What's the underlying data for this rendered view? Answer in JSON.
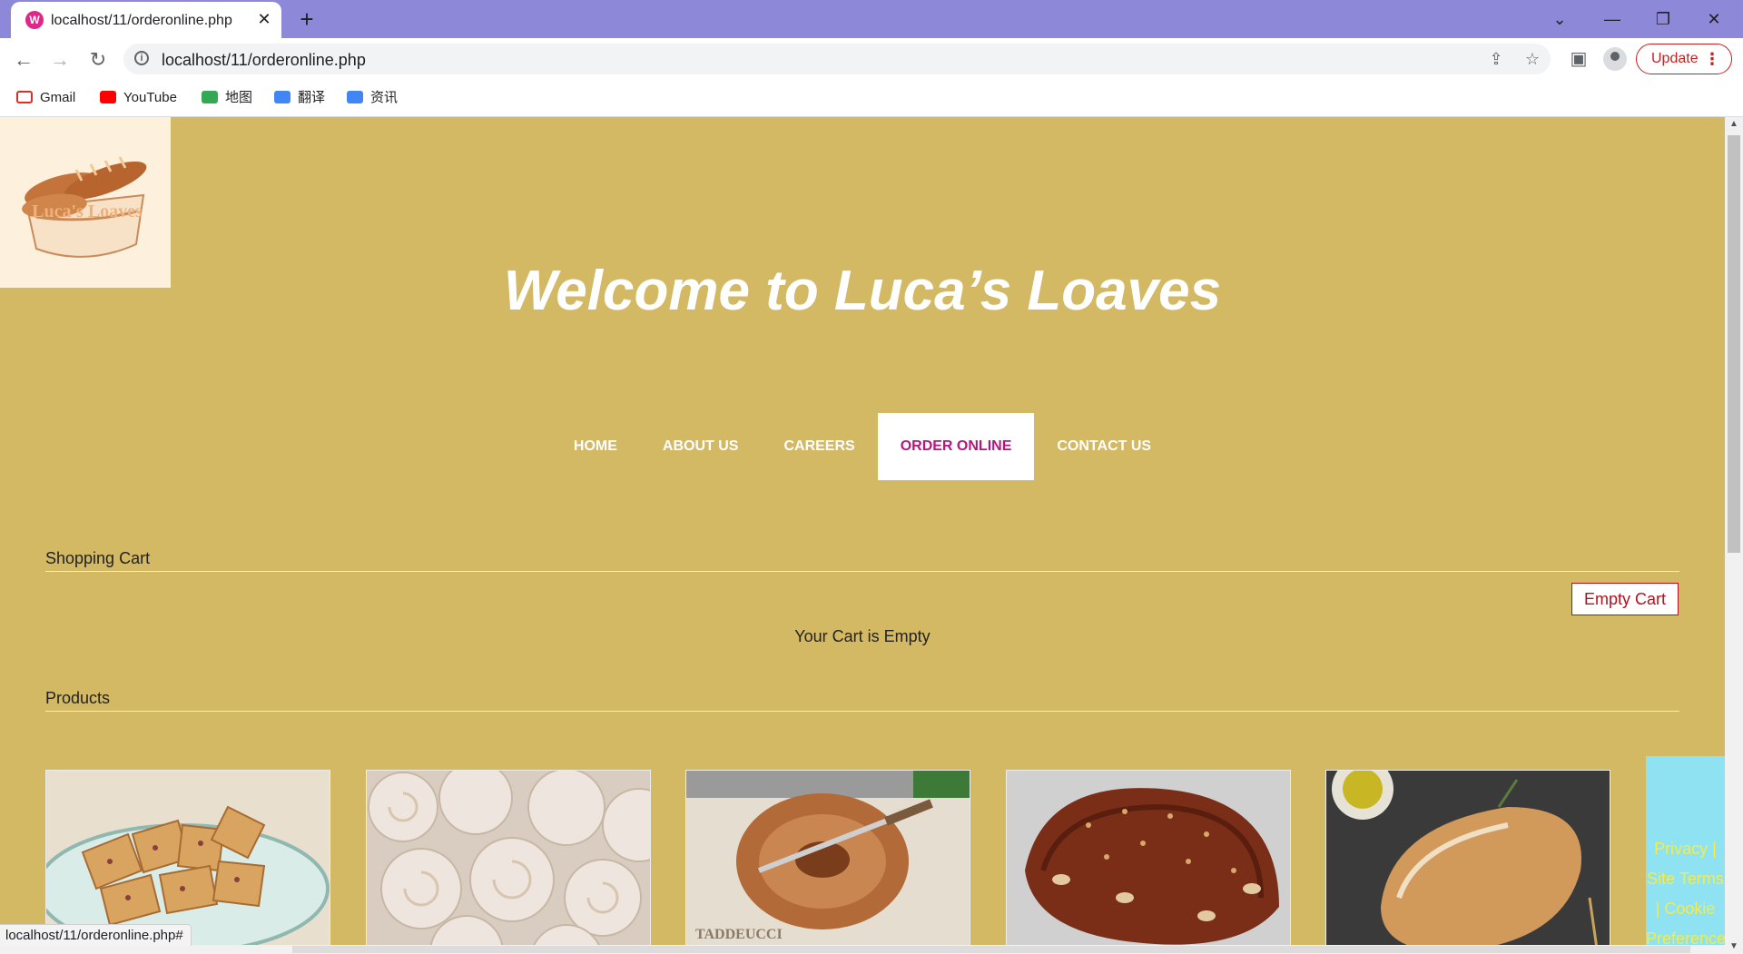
{
  "browser": {
    "tab_title": "localhost/11/orderonline.php",
    "tab_close": "✕",
    "new_tab": "+",
    "url": "localhost/11/orderonline.php",
    "update_label": "Update",
    "window_controls": [
      "⌄",
      "—",
      "❐",
      "✕"
    ],
    "bookmarks": [
      {
        "label": "Gmail",
        "icon": "gmail-icon",
        "color": "#d93025"
      },
      {
        "label": "YouTube",
        "icon": "youtube-icon",
        "color": "#ff0000"
      },
      {
        "label": "地图",
        "icon": "maps-icon",
        "color": "#34a853"
      },
      {
        "label": "翻译",
        "icon": "translate-icon",
        "color": "#4285f4"
      },
      {
        "label": "资讯",
        "icon": "news-icon",
        "color": "#4285f4"
      }
    ],
    "status_url": "localhost/11/orderonline.php#"
  },
  "site": {
    "logo_text": "Luca's Loaves",
    "welcome": "Welcome to Luca’s Loaves",
    "nav": [
      {
        "label": "HOME",
        "active": false
      },
      {
        "label": "ABOUT US",
        "active": false
      },
      {
        "label": "CAREERS",
        "active": false
      },
      {
        "label": "ORDER ONLINE",
        "active": true
      },
      {
        "label": "CONTACT US",
        "active": false
      }
    ],
    "cart_title": "Shopping Cart",
    "empty_cart_label": "Empty Cart",
    "cart_message": "Your Cart is Empty",
    "products_title": "Products",
    "footer_links": [
      "Privacy |",
      "Site Terms",
      "| Cookie",
      "Preference"
    ]
  },
  "colors": {
    "page_bg": "#d3b964",
    "tabstrip": "#8e88d8",
    "active_nav_text": "#b5157d",
    "empty_cart": "#b3121d",
    "footer_bg": "#8fe2f2",
    "footer_text": "#f5ec45"
  }
}
